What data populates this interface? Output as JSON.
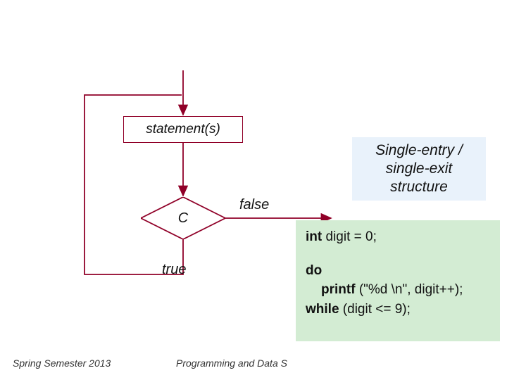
{
  "flow": {
    "statement_label": "statement(s)",
    "condition_label": "C",
    "false_label": "false",
    "true_label": "true"
  },
  "note": "Single-entry / single-exit structure",
  "code": {
    "l1_pre": "int",
    "l1_rest": "  digit = 0;",
    "l2_kw": "do",
    "l3_pre": "printf",
    "l3_rest": " (\"%d \\n\", digit++);",
    "l4_kw": "while",
    "l4_rest": " (digit <= 9);"
  },
  "footer": {
    "left": "Spring Semester 2013",
    "center": "Programming and Data S"
  },
  "colors": {
    "stroke": "#900028"
  },
  "chart_data": {
    "type": "diagram",
    "title": "",
    "description": "do-while loop flowchart",
    "nodes": [
      {
        "id": "entry",
        "type": "entry"
      },
      {
        "id": "stmt",
        "type": "process",
        "label": "statement(s)"
      },
      {
        "id": "cond",
        "type": "decision",
        "label": "C"
      },
      {
        "id": "exit",
        "type": "exit"
      }
    ],
    "edges": [
      {
        "from": "entry",
        "to": "stmt"
      },
      {
        "from": "stmt",
        "to": "cond"
      },
      {
        "from": "cond",
        "to": "stmt",
        "label": "true"
      },
      {
        "from": "cond",
        "to": "exit",
        "label": "false"
      }
    ],
    "annotation": "Single-entry / single-exit structure",
    "code_sample": "int digit = 0;\n\ndo\n   printf(\"%d \\n\", digit++);\nwhile (digit <= 9);"
  }
}
